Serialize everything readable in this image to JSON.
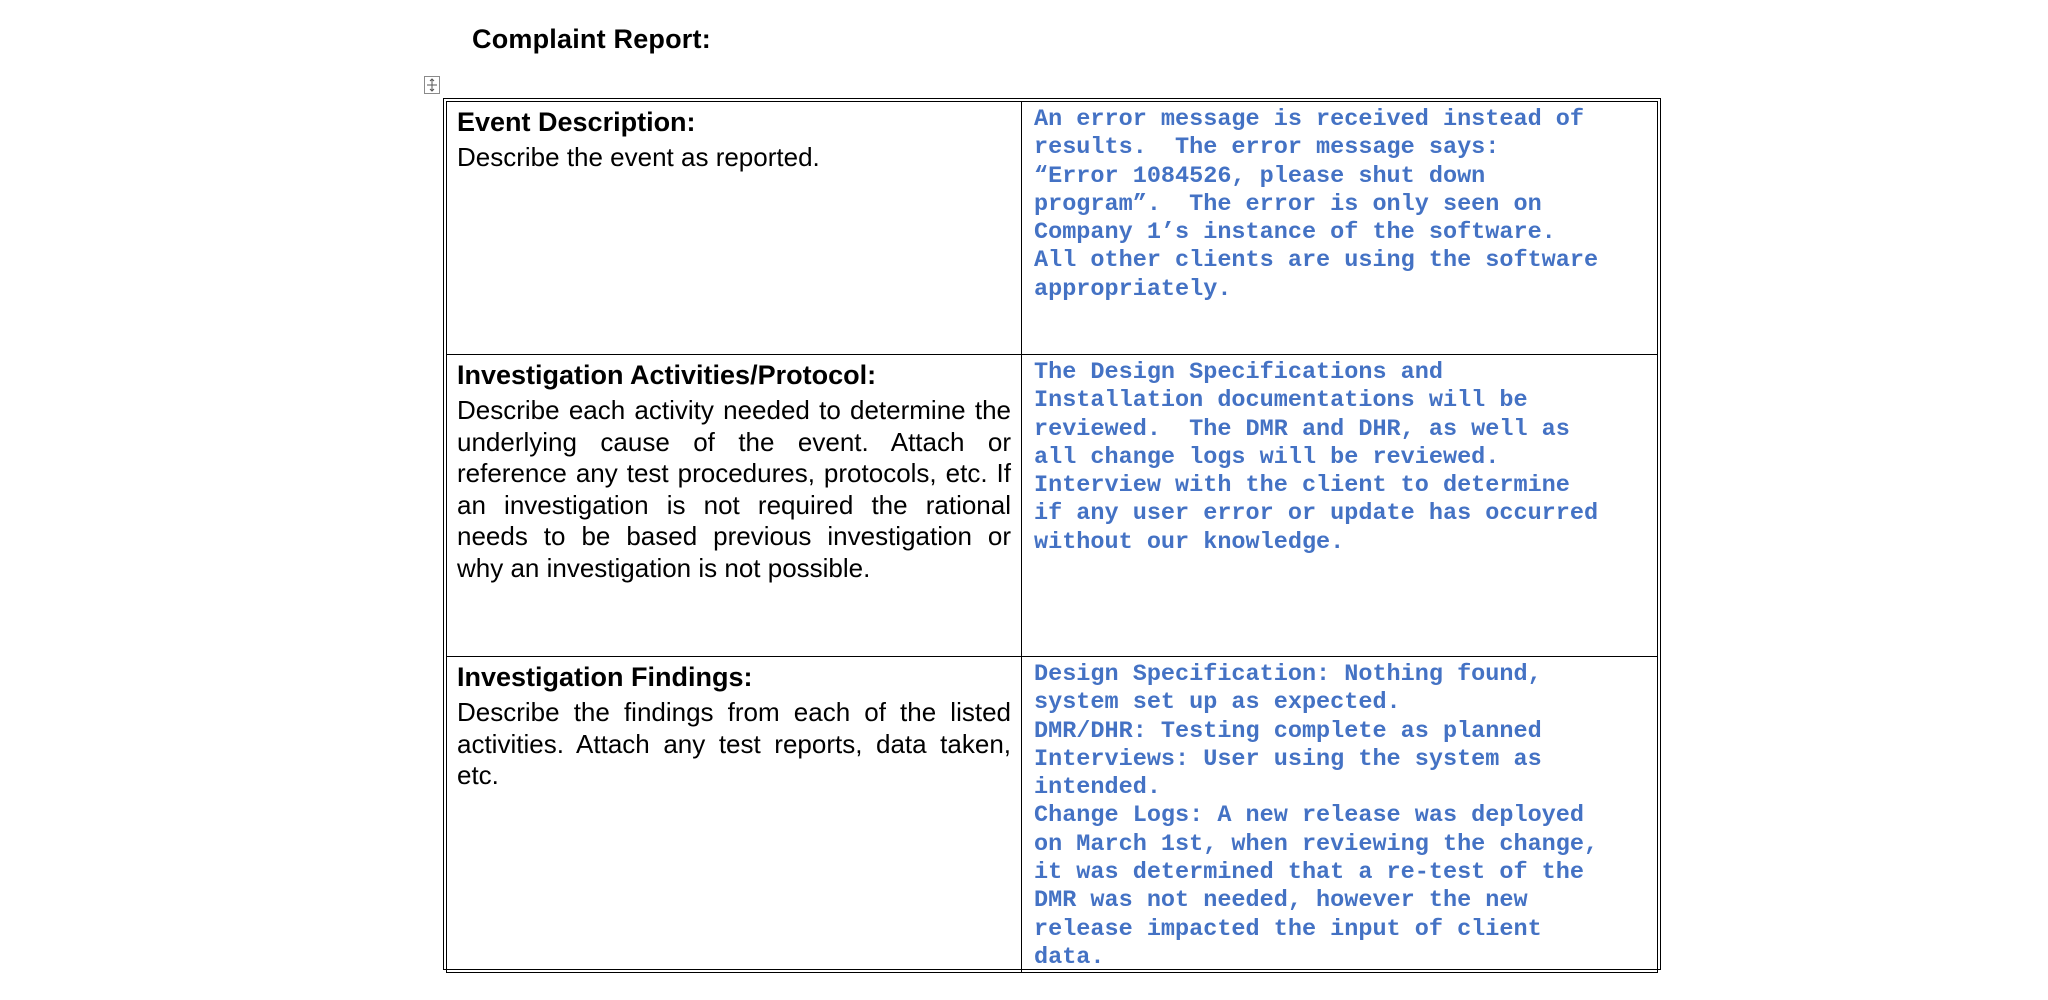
{
  "document": {
    "title": "Complaint Report:"
  },
  "report": {
    "rows": [
      {
        "heading": "Event Description:",
        "description": "Describe the event as reported.",
        "answer": "An error message is received instead of\nresults.  The error message says:\n“Error 1084526, please shut down\nprogram”.  The error is only seen on\nCompany 1’s instance of the software.\nAll other clients are using the software\nappropriately."
      },
      {
        "heading": "Investigation Activities/Protocol:",
        "description": "Describe each activity needed to determine the underlying cause of the event.  Attach or reference any test procedures, protocols, etc. If an investigation is not required the rational needs to be based previous investigation or why an investigation is not possible.",
        "answer": "The Design Specifications and\nInstallation documentations will be\nreviewed.  The DMR and DHR, as well as\nall change logs will be reviewed.\nInterview with the client to determine\nif any user error or update has occurred\nwithout our knowledge."
      },
      {
        "heading": "Investigation Findings:",
        "description": "Describe the findings from each of the listed activities.  Attach any test reports, data taken, etc.",
        "answer": "Design Specification: Nothing found,\nsystem set up as expected.\nDMR/DHR: Testing complete as planned\nInterviews: User using the system as\nintended.\nChange Logs: A new release was deployed\non March 1st, when reviewing the change,\nit was determined that a re-test of the\nDMR was not needed, however the new\nrelease impacted the input of client\ndata."
      }
    ]
  },
  "colors": {
    "answer_text": "#4472c4",
    "border": "#000000"
  },
  "icons": {
    "table_handle": "table-move-handle-icon"
  }
}
